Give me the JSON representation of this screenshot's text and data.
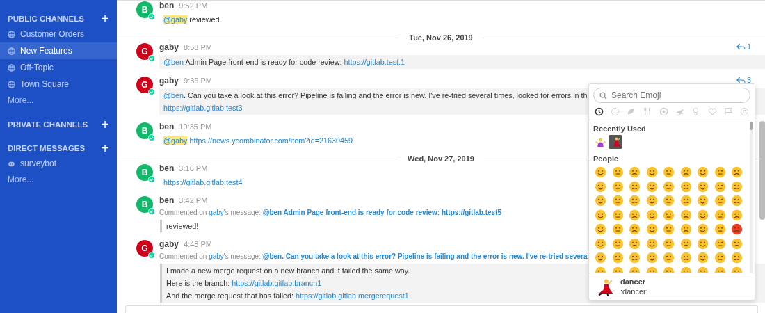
{
  "sidebar": {
    "sections": [
      {
        "title": "PUBLIC CHANNELS",
        "add": "+",
        "items": [
          {
            "label": "Customer Orders",
            "kind": "globe",
            "selected": false
          },
          {
            "label": "New Features",
            "kind": "globe",
            "selected": true
          },
          {
            "label": "Off-Topic",
            "kind": "globe",
            "selected": false
          },
          {
            "label": "Town Square",
            "kind": "globe",
            "selected": false
          }
        ],
        "more": "More..."
      },
      {
        "title": "PRIVATE CHANNELS",
        "add": "+"
      },
      {
        "title": "DIRECT MESSAGES",
        "add": "+",
        "items": [
          {
            "label": "surveybot",
            "kind": "bot",
            "selected": false
          }
        ],
        "more": "More..."
      }
    ]
  },
  "messages": [
    {
      "kind": "message",
      "author": "ben",
      "avatar": "B",
      "color": "#14b86a",
      "time": "9:52 PM",
      "boxed": false,
      "body": [
        [
          {
            "kind": "mention",
            "text": "@gaby",
            "highlight": true
          },
          {
            "kind": "text",
            "text": " reviewed"
          }
        ]
      ]
    },
    {
      "kind": "date",
      "text": "Tue, Nov 26, 2019"
    },
    {
      "kind": "message",
      "author": "gaby",
      "avatar": "G",
      "color": "#d0021b",
      "time": "8:58 PM",
      "boxed": true,
      "replies": "1",
      "body": [
        [
          {
            "kind": "mention",
            "text": "@ben",
            "highlight": false
          },
          {
            "kind": "text",
            "text": " Admin Page front-end is ready for code review: "
          },
          {
            "kind": "link",
            "text": "https://gitlab.test.1"
          }
        ]
      ]
    },
    {
      "kind": "message",
      "author": "gaby",
      "avatar": "G",
      "color": "#d0021b",
      "time": "9:36 PM",
      "boxed": true,
      "replies": "3",
      "body": [
        [
          {
            "kind": "mention",
            "text": "@ben",
            "highlight": false
          },
          {
            "kind": "text",
            "text": ". Can you take a look at this error? Pipeline is failing and the error is new. I've re-tried several times, looked for errors in th"
          }
        ],
        [
          {
            "kind": "link",
            "text": "https://gitlab.gitlab.test3"
          }
        ]
      ]
    },
    {
      "kind": "message",
      "author": "ben",
      "avatar": "B",
      "color": "#14b86a",
      "time": "10:35 PM",
      "boxed": false,
      "body": [
        [
          {
            "kind": "mention",
            "text": "@gaby",
            "highlight": true
          },
          {
            "kind": "link",
            "text": "https://news.ycombinator.com/item?id=21630459"
          }
        ]
      ]
    },
    {
      "kind": "date",
      "text": "Wed, Nov 27, 2019"
    },
    {
      "kind": "message",
      "author": "ben",
      "avatar": "B",
      "color": "#14b86a",
      "time": "3:16 PM",
      "boxed": false,
      "body": [
        [
          {
            "kind": "link",
            "text": "https://gitlab.gitlab.test4"
          }
        ]
      ]
    },
    {
      "kind": "message",
      "author": "ben",
      "avatar": "B",
      "color": "#14b86a",
      "time": "3:42 PM",
      "boxed": false,
      "comment": {
        "prefix": "Commented on ",
        "user": "gaby",
        "suffix": "'s message: ",
        "quote": "@ben Admin Page front-end is ready for code review: https://gitlab.test5"
      },
      "quoted": true,
      "body": [
        [
          {
            "kind": "text",
            "text": "reviewed!"
          }
        ]
      ]
    },
    {
      "kind": "message",
      "author": "gaby",
      "avatar": "G",
      "color": "#d0021b",
      "time": "4:48 PM",
      "boxed": true,
      "comment": {
        "prefix": "Commented on ",
        "user": "gaby",
        "suffix": "'s message: ",
        "quote": "@ben. Can you take a look at this error? Pipeline is failing and the error is new. I've re-tried severa"
      },
      "quoted": true,
      "body": [
        [
          {
            "kind": "text",
            "text": "I made a new merge request on a new branch and it failed the same way."
          }
        ],
        [
          {
            "kind": "text",
            "text": "Here is the branch: "
          },
          {
            "kind": "link",
            "text": "https://gitlab.gitlab.branch1"
          }
        ],
        [
          {
            "kind": "text",
            "text": "And the merge request that has failed: "
          },
          {
            "kind": "link",
            "text": "https://gitlab.gitlab.mergerequest1"
          }
        ]
      ]
    }
  ],
  "emoji_picker": {
    "placeholder": "Search Emoji",
    "categories": [
      {
        "selected": true
      },
      {
        "selected": false
      },
      {
        "selected": false
      },
      {
        "selected": false
      },
      {
        "selected": false
      },
      {
        "selected": false
      },
      {
        "selected": false
      },
      {
        "selected": false
      },
      {
        "selected": false
      },
      {
        "selected": false
      }
    ],
    "recent_title": "Recently Used",
    "recent": [
      {
        "selected": false
      },
      {
        "selected": true
      }
    ],
    "people_title": "People",
    "preview": {
      "name": "dancer",
      "code": ":dancer:"
    }
  }
}
